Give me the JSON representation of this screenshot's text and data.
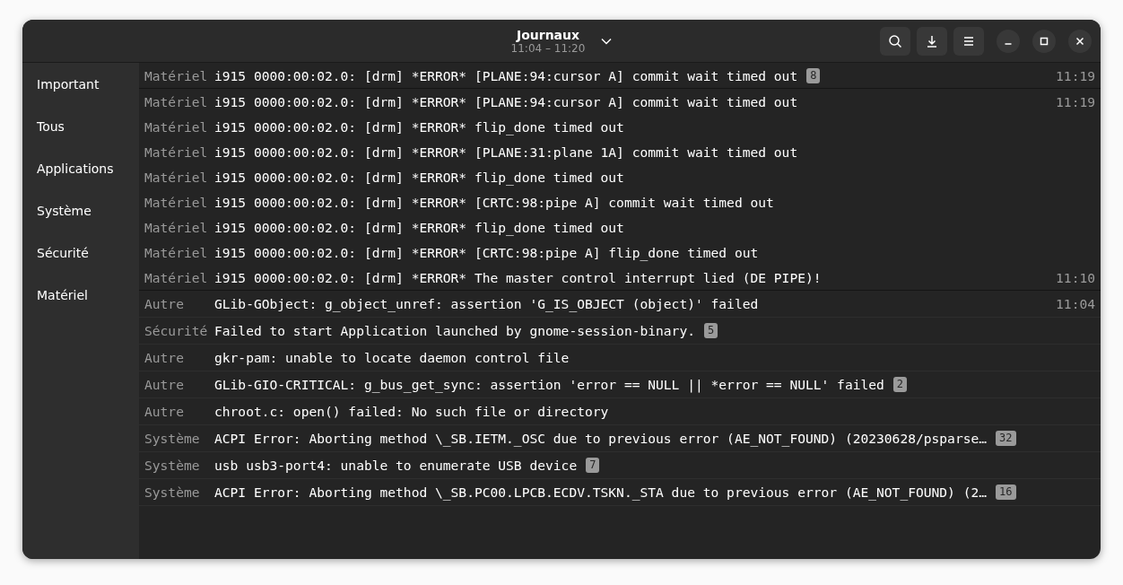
{
  "window": {
    "title": "Journaux",
    "subtitle": "11:04 – 11:20"
  },
  "sidebar": {
    "items": [
      {
        "label": "Important"
      },
      {
        "label": "Tous"
      },
      {
        "label": "Applications"
      },
      {
        "label": "Système"
      },
      {
        "label": "Sécurité"
      },
      {
        "label": "Matériel"
      }
    ]
  },
  "entries": [
    {
      "category": "Matériel",
      "message": "i915 0000:00:02.0: [drm] *ERROR* [PLANE:94:cursor A] commit wait timed out",
      "count": "8",
      "time": "11:19",
      "expanded": true,
      "children": [
        {
          "category": "Matériel",
          "message": "i915 0000:00:02.0: [drm] *ERROR* [PLANE:94:cursor A] commit wait timed out",
          "time": "11:19"
        },
        {
          "category": "Matériel",
          "message": "i915 0000:00:02.0: [drm] *ERROR* flip_done timed out"
        },
        {
          "category": "Matériel",
          "message": "i915 0000:00:02.0: [drm] *ERROR* [PLANE:31:plane 1A] commit wait timed out"
        },
        {
          "category": "Matériel",
          "message": "i915 0000:00:02.0: [drm] *ERROR* flip_done timed out"
        },
        {
          "category": "Matériel",
          "message": "i915 0000:00:02.0: [drm] *ERROR* [CRTC:98:pipe A] commit wait timed out"
        },
        {
          "category": "Matériel",
          "message": "i915 0000:00:02.0: [drm] *ERROR* flip_done timed out"
        },
        {
          "category": "Matériel",
          "message": "i915 0000:00:02.0: [drm] *ERROR* [CRTC:98:pipe A] flip_done timed out"
        },
        {
          "category": "Matériel",
          "message": "i915 0000:00:02.0: [drm] *ERROR* The master control interrupt lied (DE PIPE)!",
          "time": "11:10"
        }
      ]
    },
    {
      "category": "Autre",
      "message": "GLib-GObject: g_object_unref: assertion 'G_IS_OBJECT (object)' failed",
      "time": "11:04"
    },
    {
      "category": "Sécurité",
      "message": "Failed to start Application launched by gnome-session-binary.",
      "count": "5"
    },
    {
      "category": "Autre",
      "message": "gkr-pam: unable to locate daemon control file"
    },
    {
      "category": "Autre",
      "message": "GLib-GIO-CRITICAL: g_bus_get_sync: assertion 'error == NULL || *error == NULL' failed",
      "count": "2"
    },
    {
      "category": "Autre",
      "message": "chroot.c: open() failed: No such file or directory"
    },
    {
      "category": "Système",
      "message": "ACPI Error: Aborting method \\_SB.IETM._OSC due to previous error (AE_NOT_FOUND) (20230628/psparse…",
      "count": "32"
    },
    {
      "category": "Système",
      "message": "usb usb3-port4: unable to enumerate USB device",
      "count": "7"
    },
    {
      "category": "Système",
      "message": "ACPI Error: Aborting method \\_SB.PC00.LPCB.ECDV.TSKN._STA due to previous error (AE_NOT_FOUND) (2…",
      "count": "16"
    }
  ]
}
